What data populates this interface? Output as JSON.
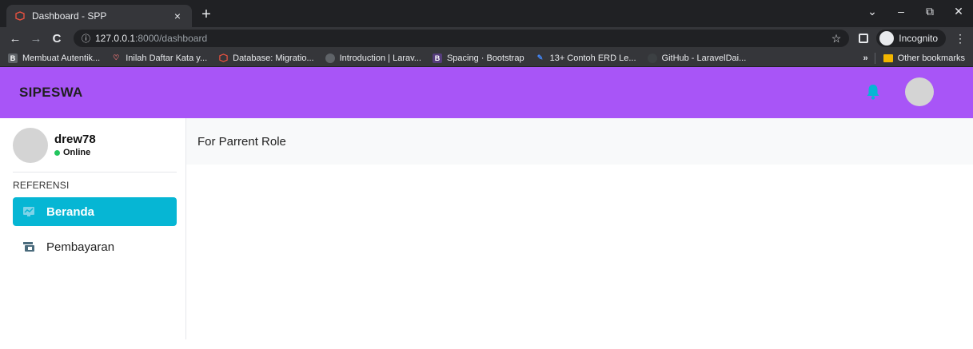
{
  "browser": {
    "tab_title": "Dashboard - SPP",
    "tab_close": "×",
    "new_tab": "+",
    "window_controls": {
      "minimize": "–",
      "maximize": "⧉",
      "close": "✕",
      "dropdown": "⌄"
    },
    "nav": {
      "back": "←",
      "forward": "→",
      "reload": "C"
    },
    "url_host": "127.0.0.1",
    "url_rest": ":8000/dashboard",
    "incognito_label": "Incognito",
    "bookmarks": [
      {
        "label": "Membuat Autentik...",
        "icon": "bookmark-app-icon",
        "color": "#3c4043"
      },
      {
        "label": "Inilah Daftar Kata y...",
        "icon": "heart-icon",
        "color": "#e57373"
      },
      {
        "label": "Database: Migratio...",
        "icon": "laravel-icon",
        "color": "#f05340"
      },
      {
        "label": "Introduction | Larav...",
        "icon": "globe-icon",
        "color": "#5f6368"
      },
      {
        "label": "Spacing · Bootstrap",
        "icon": "bootstrap-icon",
        "color": "#563d7c"
      },
      {
        "label": "13+ Contoh ERD Le...",
        "icon": "pen-icon",
        "color": "#4285f4"
      },
      {
        "label": "GitHub - LaravelDai...",
        "icon": "github-icon",
        "color": "#3c4043"
      }
    ],
    "bookmarks_overflow": "»",
    "other_bookmarks": "Other bookmarks"
  },
  "app": {
    "brand": "SIPESWA",
    "accent": "#a855f7",
    "user": {
      "name": "drew78",
      "status": "Online"
    },
    "section_label": "REFERENSI",
    "nav": [
      {
        "label": "Beranda",
        "icon": "dashboard-icon",
        "active": true
      },
      {
        "label": "Pembayaran",
        "icon": "payment-icon",
        "active": false
      }
    ],
    "content_title": "For Parrent Role"
  }
}
